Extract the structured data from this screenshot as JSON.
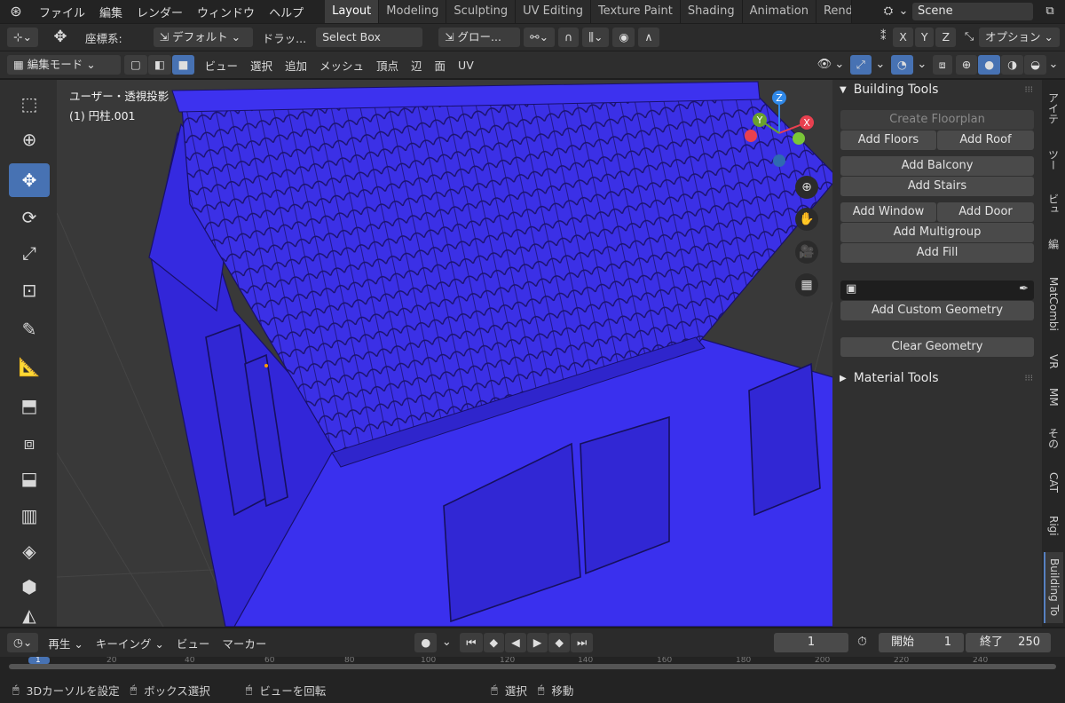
{
  "topbar": {
    "menus": [
      "ファイル",
      "編集",
      "レンダー",
      "ウィンドウ",
      "ヘルプ"
    ],
    "workspaces": [
      "Layout",
      "Modeling",
      "Sculpting",
      "UV Editing",
      "Texture Paint",
      "Shading",
      "Animation",
      "Rend"
    ],
    "active_workspace": "Layout",
    "scene": "Scene"
  },
  "header1": {
    "coord_label": "座標系:",
    "orientation": "デフォルト",
    "drag_label": "ドラッ...",
    "select_mode": "Select Box",
    "transform_orient": "グロー...",
    "axes": [
      "X",
      "Y",
      "Z"
    ],
    "options": "オプション"
  },
  "header2": {
    "mode": "編集モード",
    "menus": [
      "ビュー",
      "選択",
      "追加",
      "メッシュ",
      "頂点",
      "辺",
      "面",
      "UV"
    ]
  },
  "viewport": {
    "view_name": "ユーザー・透視投影",
    "object_name": "(1) 円柱.001",
    "gizmo": {
      "x": "X",
      "y": "Y",
      "z": "Z"
    },
    "colors": {
      "mesh": "#3a2fe0",
      "mesh_dark": "#2a20b0",
      "edge": "#1a1266",
      "grid": "#474747"
    }
  },
  "panel": {
    "building_tools_title": "Building Tools",
    "create_floorplan": "Create Floorplan",
    "add_floors": "Add Floors",
    "add_roof": "Add Roof",
    "add_balcony": "Add Balcony",
    "add_stairs": "Add Stairs",
    "add_window": "Add Window",
    "add_door": "Add Door",
    "add_multigroup": "Add Multigroup",
    "add_fill": "Add Fill",
    "add_custom_geometry": "Add Custom Geometry",
    "clear_geometry": "Clear Geometry",
    "material_tools_title": "Material Tools"
  },
  "tabs": [
    "アイテ",
    "ツー",
    "ビュ",
    "編",
    "MatCombi",
    "VR",
    "MM",
    "その",
    "CAT",
    "Rigi",
    "Building To"
  ],
  "timeline": {
    "playback": "再生",
    "keying": "キーイング",
    "view": "ビュー",
    "marker": "マーカー",
    "current_frame": "1",
    "start_label": "開始",
    "start": "1",
    "end_label": "終了",
    "end": "250",
    "ruler": [
      "1",
      "20",
      "40",
      "60",
      "80",
      "100",
      "120",
      "140",
      "160",
      "180",
      "200",
      "220",
      "240"
    ]
  },
  "status": {
    "set_cursor": "3Dカーソルを設定",
    "box_select": "ボックス選択",
    "rotate_view": "ビューを回転",
    "select": "選択",
    "move": "移動"
  }
}
